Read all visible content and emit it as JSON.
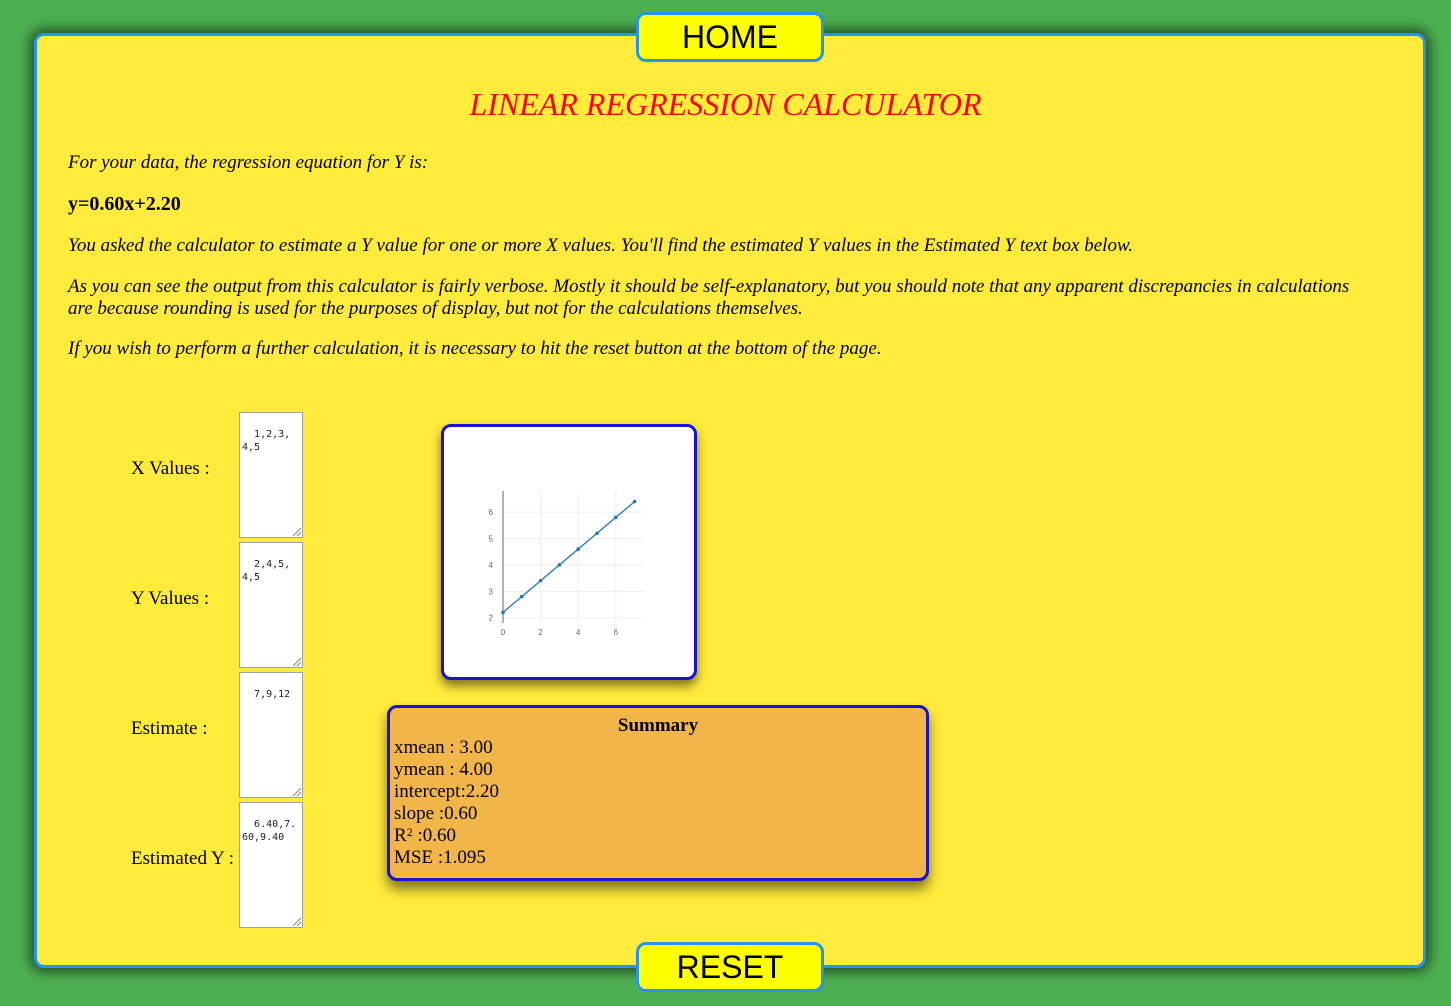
{
  "nav": {
    "home_label": "HOME",
    "reset_label": "RESET"
  },
  "page": {
    "title": "LINEAR REGRESSION CALCULATOR",
    "intro": "For your data, the regression equation for Y is:",
    "equation": "y=0.60x+2.20",
    "para_estimate": "You asked the calculator to estimate a Y value for one or more X values. You'll find the estimated Y values in the Estimated Y text box below.",
    "para_verbose": "As you can see the output from this calculator is fairly verbose. Mostly it should be self-explanatory, but you should note that any apparent discrepancies in calculations are because rounding is used for the purposes of display, but not for the calculations themselves.",
    "para_reset": "If you wish to perform a further calculation, it is necessary to hit the reset button at the bottom of the page."
  },
  "inputs": {
    "x_label": "X Values :",
    "x_value": "1,2,3,4,5",
    "y_label": "Y Values :",
    "y_value": "2,4,5,4,5",
    "estimate_label": "Estimate :",
    "estimate_value": "7,9,12",
    "estimated_y_label": "Estimated Y :",
    "estimated_y_value": "6.40,7.60,9.40"
  },
  "summary": {
    "heading": "Summary",
    "xmean": "xmean : 3.00",
    "ymean": "ymean : 4.00",
    "intercept": "intercept:2.20",
    "slope": "slope :0.60",
    "r2_prefix": "R",
    "r2_sup": "2",
    "r2_value": " :0.60",
    "mse": "MSE :1.095"
  },
  "chart_data": {
    "type": "line",
    "x": [
      0,
      1,
      2,
      3,
      4,
      5,
      6,
      7
    ],
    "y": [
      2.2,
      2.8,
      3.4,
      4.0,
      4.6,
      5.2,
      5.8,
      6.4
    ],
    "xlim": [
      0,
      7.5
    ],
    "ylim": [
      1.8,
      6.8
    ],
    "xticks": [
      0,
      2,
      4,
      6
    ],
    "yticks": [
      2,
      3,
      4,
      5,
      6
    ],
    "grid": true,
    "color": "#1f77b4"
  }
}
